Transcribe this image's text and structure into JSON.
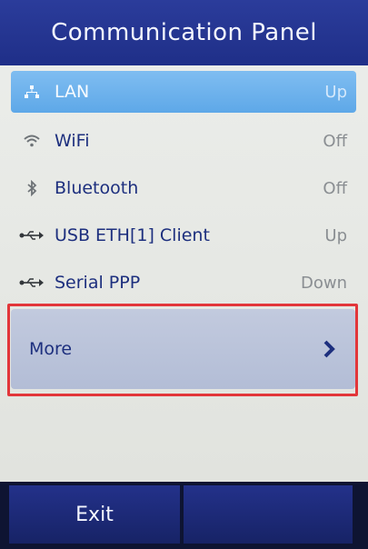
{
  "header": {
    "title": "Communication Panel"
  },
  "items": [
    {
      "label": "LAN",
      "status": "Up",
      "icon": "lan-icon",
      "selected": true
    },
    {
      "label": "WiFi",
      "status": "Off",
      "icon": "wifi-icon"
    },
    {
      "label": "Bluetooth",
      "status": "Off",
      "icon": "bluetooth-icon"
    },
    {
      "label": "USB ETH[1] Client",
      "status": "Up",
      "icon": "usb-icon"
    },
    {
      "label": "Serial PPP",
      "status": "Down",
      "icon": "usb-icon"
    }
  ],
  "more": {
    "label": "More",
    "icon": "chevron-right-icon"
  },
  "footer": {
    "exit_label": "Exit",
    "right_label": ""
  },
  "colors": {
    "header_bg": "#24358f",
    "selected_row": "#6aaeea",
    "text": "#1d2f7e",
    "highlight": "#e2363a"
  }
}
